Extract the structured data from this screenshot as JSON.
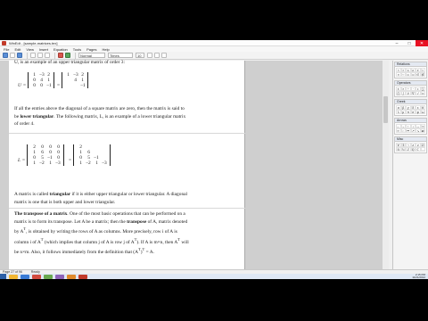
{
  "window": {
    "title": "WinEdt - [sample-matrices.tex]",
    "min_label": "–",
    "max_label": "□",
    "close_label": "✕"
  },
  "menubar": {
    "items": [
      "File",
      "Edit",
      "View",
      "Insert",
      "Equation",
      "Tools",
      "Pages",
      "Help"
    ]
  },
  "toolbar": {
    "font_label": "Times",
    "size_label": "10",
    "style_label": "Normal"
  },
  "document": {
    "top_fragment": "U, is an example of an upper triangular matrix of order 3:",
    "lower_para_part1": "If all the entries above the diagonal of a square matrix are zero, then the matrix is said to be ",
    "lower_bold": "lower triangular",
    "lower_para_part2": ". The following matrix, L, is an example of a lower triangular matrix of order 4.",
    "tri_para_part1": "A matrix is called ",
    "tri_bold": "triangular",
    "tri_para_part2": " if it is either upper triangular or lower triangular. A diagonal matrix is one that is both upper and lower triangular.",
    "transpose_title": "The transpose of a matrix",
    "transpose_para1": ". One of the most basic operations that can be performed on a matrix is to form its transpose. Let A be a matrix; then the ",
    "transpose_bold2": "transpose",
    "transpose_para2": " of A, matrix denoted by A",
    "transpose_para3": ", is obtained by writing the rows of A as columns. More precisely, row i of A is column i of A",
    "transpose_para4": " (which implies that column j of A is row j of A",
    "transpose_para5": "). If A is m×n, then A",
    "transpose_para6": " will be n×m. Also, it follows immediately from the definition that (A",
    "transpose_para7": ")",
    "transpose_para8": " = A.",
    "sup_t": "T",
    "upper_var": "U",
    "lower_var": "L",
    "eq_sign": "=",
    "matrix_u_left": [
      "1",
      "−3",
      "2",
      "0",
      "4",
      "1",
      "0",
      "0",
      "−1"
    ],
    "matrix_u_right": [
      "1",
      "−3",
      "2",
      "",
      "4",
      "1",
      "",
      "",
      "−1"
    ],
    "matrix_l_left": [
      "2",
      "0",
      "0",
      "0",
      "1",
      "6",
      "0",
      "0",
      "0",
      "5",
      "−1",
      "0",
      "1",
      "−2",
      "1",
      "−3"
    ],
    "matrix_l_right": [
      "2",
      "",
      "",
      "",
      "1",
      "6",
      "",
      "",
      "0",
      "5",
      "−1",
      "",
      "1",
      "−2",
      "1",
      "−3"
    ]
  },
  "panel": {
    "sections": [
      {
        "title": "Relations",
        "symbols": [
          "<",
          ">",
          "≤",
          "≥",
          "≠",
          "≈",
          "≡",
          "∼",
          "⊂",
          "⊃",
          "∈",
          "∉"
        ]
      },
      {
        "title": "Operators",
        "symbols": [
          "±",
          "×",
          "÷",
          "·",
          "∘",
          "∑",
          "∏",
          "∫",
          "∂",
          "∇",
          "√",
          "∞"
        ]
      },
      {
        "title": "Greek",
        "symbols": [
          "α",
          "β",
          "γ",
          "δ",
          "ε",
          "θ",
          "λ",
          "μ",
          "π",
          "σ",
          "φ",
          "ω"
        ]
      },
      {
        "title": "Arrows",
        "symbols": [
          "←",
          "→",
          "↑",
          "↓",
          "↔",
          "⇒",
          "⇐",
          "⇔",
          "↦",
          "↗",
          "↘",
          "⇌"
        ]
      },
      {
        "title": "Misc",
        "symbols": [
          "∀",
          "∃",
          "¬",
          "∧",
          "∨",
          "∅",
          "ℝ",
          "ℕ",
          "ℤ",
          "ℚ",
          "ℂ",
          "…"
        ]
      }
    ]
  },
  "status": {
    "page": "Page 27 of 96",
    "mode": "Ready"
  },
  "taskbar": {
    "time": "2:15 PM",
    "date": "11/21/2012"
  },
  "colors": {
    "accent": "#2c5fa6",
    "close": "#e81123"
  }
}
